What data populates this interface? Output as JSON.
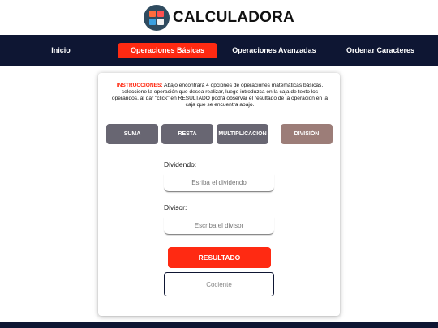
{
  "header": {
    "title": "CALCULADORA",
    "logo_icon": "calculator-icon",
    "logo_colors": [
      "#ff6b3d",
      "#3ba0e0",
      "#6ad0a0",
      "#f2f2f2"
    ]
  },
  "nav": {
    "items": [
      {
        "label": "Inicio",
        "active": false
      },
      {
        "label": "Operaciones Básicas",
        "active": true
      },
      {
        "label": "Operaciones Avanzadas",
        "active": false
      },
      {
        "label": "Ordenar Caracteres",
        "active": false
      }
    ]
  },
  "card": {
    "instructions_label": "INSTRUCCIONES:",
    "instructions_text": " Abajo encontrará 4 opciones de operaciones matemáticas básicas, seleccione la operación que desea realizar, luego introduzca en la caja de texto los operandos, al dar \"click\" en RESULTADO podrá observar el resultado de la operacion en la caja que se encuentra abajo.",
    "operations": [
      {
        "label": "SUMA",
        "selected": false
      },
      {
        "label": "RESTA",
        "selected": false
      },
      {
        "label": "MULTIPLICACIÓN",
        "selected": false
      },
      {
        "label": "DIVISIÓN",
        "selected": true
      }
    ],
    "dividend_label": "Dividendo:",
    "dividend_placeholder": "Esriba el dividendo",
    "dividend_value": "",
    "divisor_label": "Divisor:",
    "divisor_placeholder": "Escriba el divisor",
    "divisor_value": "",
    "result_button": "RESULTADO",
    "quotient_placeholder": "Cociente",
    "quotient_value": ""
  },
  "colors": {
    "nav_bg": "#0e1633",
    "accent": "#ff2a12",
    "op_button": "#686672",
    "op_selected": "#9c7d78"
  }
}
